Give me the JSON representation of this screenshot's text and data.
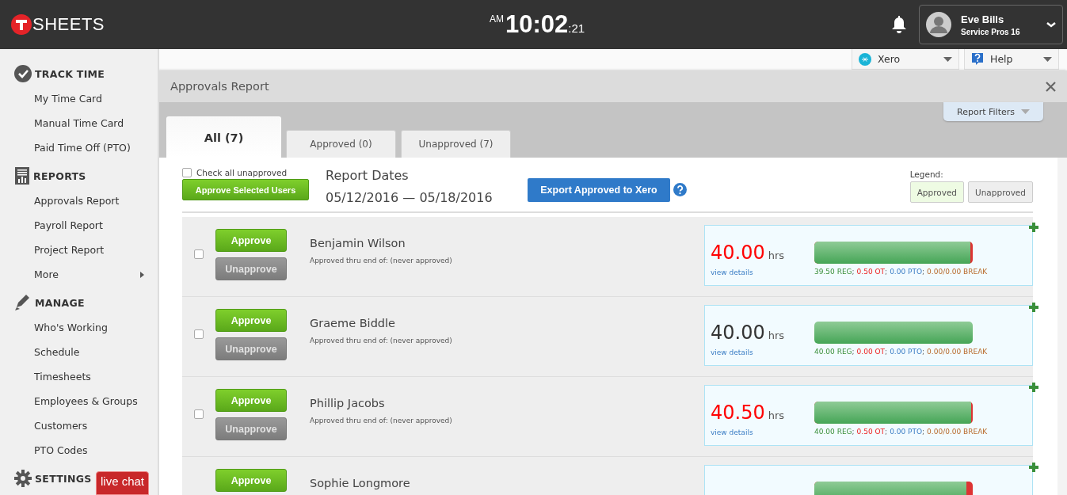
{
  "header": {
    "logo": "SHEETS",
    "clock": {
      "meridiem": "AM",
      "time": "10:02",
      "seconds": ":21"
    },
    "user": {
      "name": "Eve Bills",
      "company": "Service Pros 16"
    }
  },
  "sidebar": {
    "sections": [
      {
        "kind": "track",
        "title": "TRACK TIME",
        "items": [
          {
            "label": "My Time Card",
            "submenu": false
          },
          {
            "label": "Manual Time Card",
            "submenu": false
          },
          {
            "label": "Paid Time Off (PTO)",
            "submenu": false
          }
        ]
      },
      {
        "kind": "reports",
        "title": "REPORTS",
        "items": [
          {
            "label": "Approvals Report",
            "submenu": false
          },
          {
            "label": "Payroll Report",
            "submenu": false
          },
          {
            "label": "Project Report",
            "submenu": false
          },
          {
            "label": "More",
            "submenu": true
          }
        ]
      },
      {
        "kind": "manage",
        "title": "MANAGE",
        "items": [
          {
            "label": "Who's Working",
            "submenu": false
          },
          {
            "label": "Schedule",
            "submenu": false
          },
          {
            "label": "Timesheets",
            "submenu": false
          },
          {
            "label": "Employees & Groups",
            "submenu": false
          },
          {
            "label": "Customers",
            "submenu": false
          },
          {
            "label": "PTO Codes",
            "submenu": false
          }
        ]
      },
      {
        "kind": "settings",
        "title": "SETTINGS"
      }
    ],
    "live_chat": "live chat"
  },
  "toolbar": {
    "menus": [
      {
        "kind": "xero",
        "label": "Xero"
      },
      {
        "kind": "help",
        "label": "Help"
      }
    ]
  },
  "report": {
    "title": "Approvals Report",
    "filters": "Report Filters",
    "tabs": [
      {
        "label": "All (7)",
        "selected": true
      },
      {
        "label": "Approved (0)",
        "selected": false
      },
      {
        "label": "Unapproved (7)",
        "selected": false
      }
    ],
    "check_all": {
      "label": "Check all unapproved",
      "checked": false
    },
    "approve_selected": "Approve Selected Users",
    "dates_label": "Report Dates",
    "dates": "05/12/2016 — 05/18/2016",
    "export": "Export Approved to Xero",
    "legend": {
      "title": "Legend:",
      "items": [
        {
          "label": "Approved",
          "kind": "approved"
        },
        {
          "label": "Unapproved",
          "kind": "unapproved"
        }
      ]
    },
    "employees": [
      {
        "checked": false,
        "approve": "Approve",
        "unapprove": {
          "label": "Unapprove",
          "disabled": true
        },
        "name": "Benjamin Wilson",
        "status": "Approved thru end of: (never approved)",
        "hours": "40.00",
        "unit": "hrs",
        "overtime": true,
        "link": "view details",
        "level": 0.985,
        "breakdown": [
          {
            "kind": "reg",
            "text": "39.50 REG"
          },
          {
            "kind": "sep",
            "text": ";"
          },
          {
            "kind": "ot",
            "text": "0.50 OT"
          },
          {
            "kind": "sep",
            "text": ";"
          },
          {
            "kind": "pto",
            "text": "0.00 PTO"
          },
          {
            "kind": "sep",
            "text": ";"
          },
          {
            "kind": "break",
            "text": "0.00/0.00 BREAK"
          }
        ]
      },
      {
        "checked": false,
        "approve": "Approve",
        "unapprove": {
          "label": "Unapprove",
          "disabled": true
        },
        "name": "Graeme Biddle",
        "status": "Approved thru end of: (never approved)",
        "hours": "40.00",
        "unit": "hrs",
        "overtime": false,
        "link": "view details",
        "level": 1,
        "breakdown": [
          {
            "kind": "reg",
            "text": "40.00 REG"
          },
          {
            "kind": "sep",
            "text": ";"
          },
          {
            "kind": "ot",
            "text": "0.00 OT"
          },
          {
            "kind": "sep",
            "text": ";"
          },
          {
            "kind": "pto",
            "text": "0.00 PTO"
          },
          {
            "kind": "sep",
            "text": ";"
          },
          {
            "kind": "break",
            "text": "0.00/0.00 BREAK"
          }
        ]
      },
      {
        "checked": false,
        "approve": "Approve",
        "unapprove": {
          "label": "Unapprove",
          "disabled": true
        },
        "name": "Phillip Jacobs",
        "status": "Approved thru end of: (never approved)",
        "hours": "40.50",
        "unit": "hrs",
        "overtime": true,
        "link": "view details",
        "level": 0.988,
        "breakdown": [
          {
            "kind": "reg",
            "text": "40.00 REG"
          },
          {
            "kind": "sep",
            "text": ";"
          },
          {
            "kind": "ot",
            "text": "0.50 OT"
          },
          {
            "kind": "sep",
            "text": ";"
          },
          {
            "kind": "pto",
            "text": "0.00 PTO"
          },
          {
            "kind": "sep",
            "text": ";"
          },
          {
            "kind": "break",
            "text": "0.00/0.00 BREAK"
          }
        ]
      },
      {
        "approve": "Approve",
        "name": "Sophie Longmore",
        "level": 0.96
      }
    ]
  }
}
